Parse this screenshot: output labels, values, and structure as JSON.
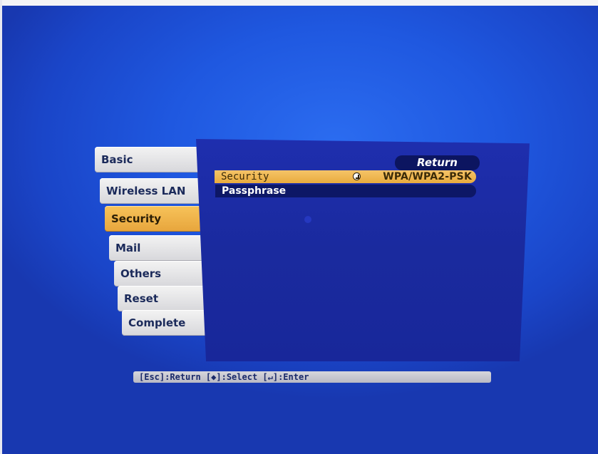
{
  "menu": {
    "tabs": [
      {
        "label": "Basic",
        "active": false
      },
      {
        "label": "Wireless LAN",
        "active": false
      },
      {
        "label": "Security",
        "active": true
      },
      {
        "label": "Mail",
        "active": false
      },
      {
        "label": "Others",
        "active": false
      },
      {
        "label": "Reset",
        "active": false
      },
      {
        "label": "Complete",
        "active": false
      }
    ]
  },
  "panel": {
    "return_label": "Return",
    "rows": [
      {
        "label": "Security",
        "value": "WPA/WPA2-PSK",
        "value_icon": "enter-icon",
        "selected": true
      },
      {
        "label": "Passphrase",
        "value": "",
        "selected": false
      }
    ]
  },
  "help": {
    "text": "[Esc]:Return [◆]:Select [↵]:Enter"
  },
  "colors": {
    "background": "#1f58e0",
    "panel": "#1a2a9e",
    "highlight": "#efb84f",
    "tab": "#e2e2e6"
  }
}
